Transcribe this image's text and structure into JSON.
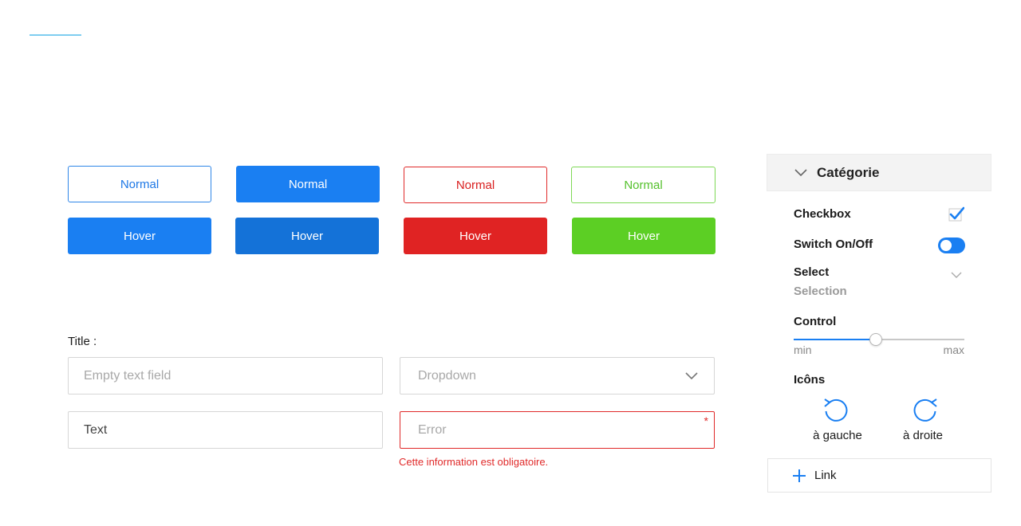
{
  "buttons": {
    "normal_label": "Normal",
    "hover_label": "Hover"
  },
  "form": {
    "title": "Title :",
    "empty_placeholder": "Empty text field",
    "dropdown_placeholder": "Dropdown",
    "text_value": "Text",
    "error_placeholder": "Error",
    "required_mark": "*",
    "error_message": "Cette information est obligatoire."
  },
  "panel": {
    "category": "Catégorie",
    "checkbox_label": "Checkbox",
    "checkbox_checked": true,
    "switch_label": "Switch On/Off",
    "switch_on": true,
    "select_label": "Select",
    "select_value": "Selection",
    "control_label": "Control",
    "slider_min": "min",
    "slider_max": "max",
    "slider_value": 0.48,
    "icons_label": "Icôns",
    "rotate_left_label": "à gauche",
    "rotate_right_label": "à droite",
    "link_label": "Link"
  },
  "colors": {
    "primary": "#1a7ff2",
    "primary_dark": "#1472d8",
    "danger": "#e02323",
    "success": "#5ccf24",
    "accent_line": "#7fcdf0"
  }
}
